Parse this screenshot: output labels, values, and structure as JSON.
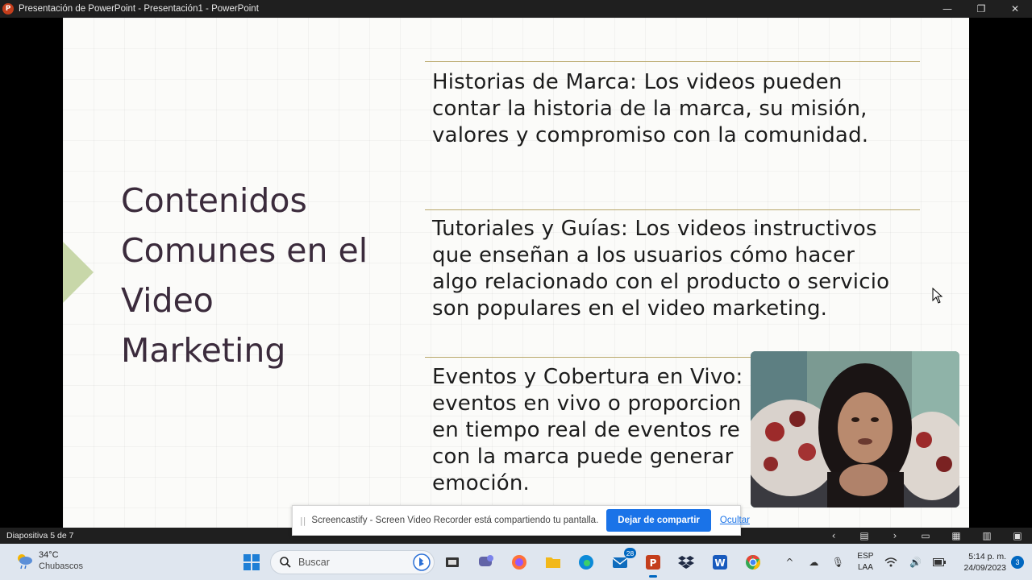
{
  "window": {
    "app_badge": "P",
    "title": "Presentación de PowerPoint  -  Presentación1 - PowerPoint",
    "controls": {
      "minimize": "—",
      "restore": "❐",
      "close": "✕"
    }
  },
  "slide": {
    "title": "Contenidos Comunes en el Video Marketing",
    "bullets": [
      {
        "lines": [
          "Historias de Marca: Los videos pueden",
          "contar la historia de la marca, su misión,",
          "valores y compromiso con la comunidad."
        ]
      },
      {
        "lines": [
          "Tutoriales y Guías: Los videos instructivos",
          "que enseñan a los usuarios cómo hacer",
          "algo relacionado con el producto o servicio",
          "son populares en el video marketing."
        ]
      },
      {
        "lines": [
          "Eventos y Cobertura en Vivo:",
          "eventos en vivo o proporcion",
          "en tiempo real de eventos re",
          "con la marca puede generar",
          "emoción."
        ]
      }
    ],
    "colors": {
      "title": "#3b2b3c",
      "accent_chevron": "#c8d7a9",
      "rule": "#b9a76a"
    }
  },
  "status_bar": {
    "slide_counter": "Diapositiva 5 de 7"
  },
  "share_banner": {
    "message": "Screencastify - Screen Video Recorder está compartiendo tu pantalla.",
    "stop_button": "Dejar de compartir",
    "hide_link": "Ocultar"
  },
  "taskbar": {
    "weather": {
      "temp": "34°C",
      "condition": "Chubascos"
    },
    "search_placeholder": "Buscar",
    "mail_badge": "28",
    "language": {
      "line1": "ESP",
      "line2": "LAA"
    },
    "clock": {
      "time": "5:14 p. m.",
      "date": "24/09/2023"
    },
    "notifications": "3"
  }
}
